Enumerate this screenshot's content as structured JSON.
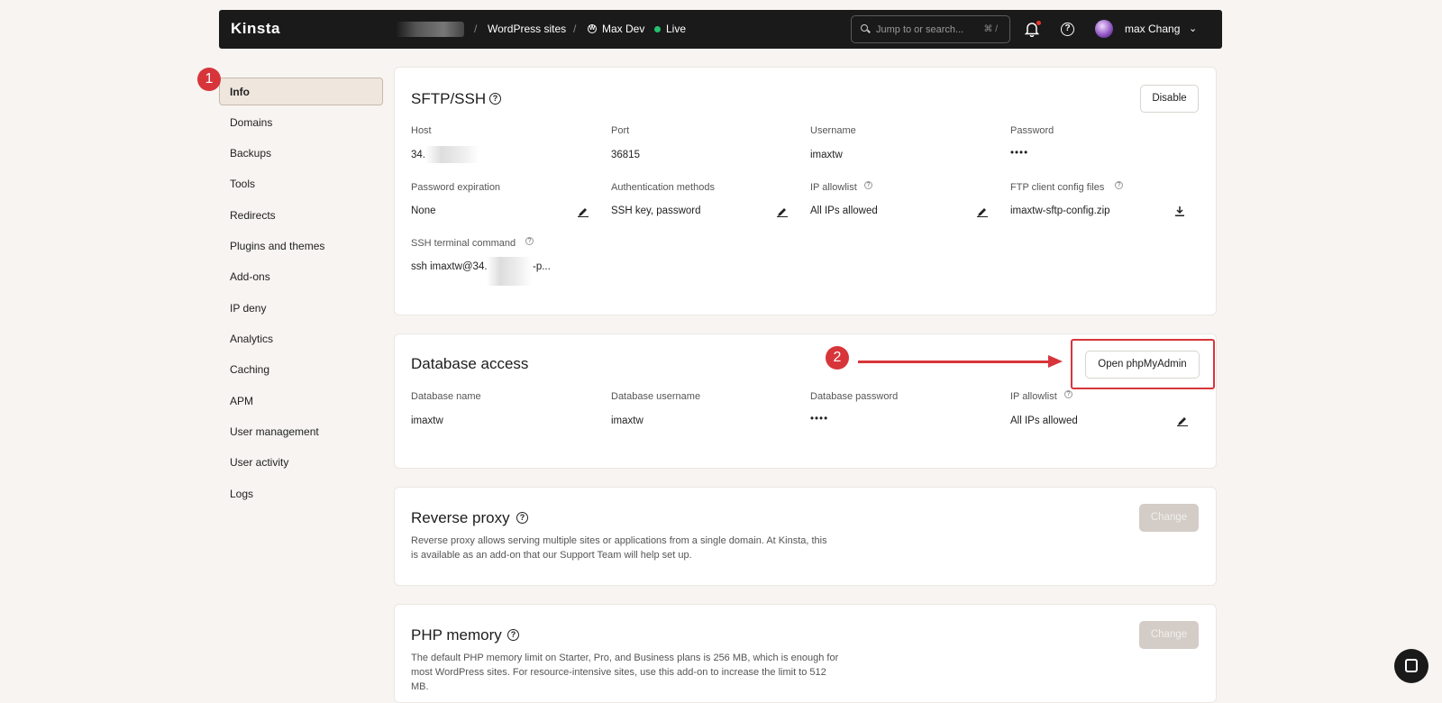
{
  "topbar": {
    "logo": "Kinsta",
    "crumbs": [
      "WordPress sites",
      "Max Dev",
      "Live"
    ],
    "search_placeholder": "Jump to or search...",
    "search_shortcut": "⌘ /",
    "user_name": "max Chang"
  },
  "sidebar": {
    "items": [
      "Info",
      "Domains",
      "Backups",
      "Tools",
      "Redirects",
      "Plugins and themes",
      "Add-ons",
      "IP deny",
      "Analytics",
      "Caching",
      "APM",
      "User management",
      "User activity",
      "Logs"
    ]
  },
  "annotations": {
    "step1": "1",
    "step2": "2"
  },
  "sftp": {
    "title": "SFTP/SSH",
    "disable_label": "Disable",
    "host_label": "Host",
    "host_value": "34.",
    "port_label": "Port",
    "port_value": "36815",
    "username_label": "Username",
    "username_value": "imaxtw",
    "password_label": "Password",
    "password_value": "••••",
    "pwexp_label": "Password expiration",
    "pwexp_value": "None",
    "auth_label": "Authentication methods",
    "auth_value": "SSH key, password",
    "ipallow_label": "IP allowlist",
    "ipallow_value": "All IPs allowed",
    "ftp_label": "FTP client config files",
    "ftp_value": "imaxtw-sftp-config.zip",
    "ssh_label": "SSH terminal command",
    "ssh_value_a": "ssh imaxtw@34.",
    "ssh_value_b": "-p..."
  },
  "database": {
    "title": "Database access",
    "open_label": "Open phpMyAdmin",
    "dbname_label": "Database name",
    "dbname_value": "imaxtw",
    "dbuser_label": "Database username",
    "dbuser_value": "imaxtw",
    "dbpass_label": "Database password",
    "dbpass_value": "••••",
    "ipallow_label": "IP allowlist",
    "ipallow_value": "All IPs allowed"
  },
  "proxy": {
    "title": "Reverse proxy",
    "desc1": "Reverse proxy allows serving multiple sites or applications from a single domain. At Kinsta, this",
    "desc2": "is available as an add-on that our Support Team will help set up.",
    "change_label": "Change"
  },
  "php": {
    "title": "PHP memory",
    "desc1": "The default PHP memory limit on Starter, Pro, and Business plans is 256 MB, which is enough for",
    "desc2": "most WordPress sites. For resource-intensive sites, use this add-on to increase the limit to 512",
    "desc3": "MB.",
    "change_label": "Change"
  }
}
